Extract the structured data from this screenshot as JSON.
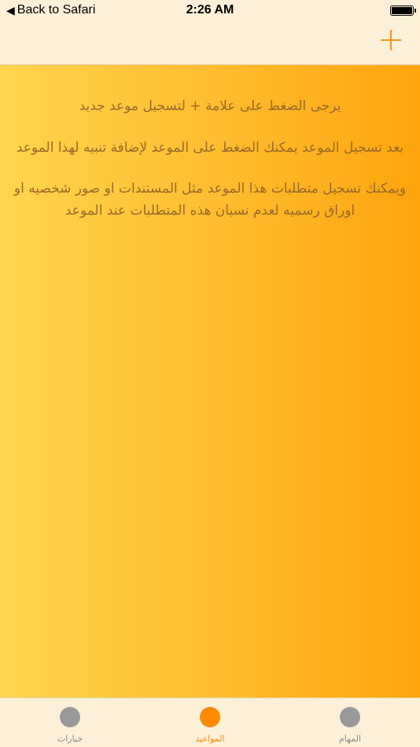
{
  "status_bar": {
    "back_label": "Back to Safari",
    "time": "2:26 AM"
  },
  "nav": {
    "add_icon": "plus-icon"
  },
  "instructions": {
    "line1": "يرجى الضغط على علامة + لتسجيل موعد جديد",
    "line2": "بعد تسجيل الموعد يمكنك الضغط على الموعد لإضافة تنبيه لهذا الموعد",
    "line3": "ويمكنك تسجيل متطلبات هذا الموعد مثل المستندات او صور شخصيه او اوراق رسميه لعدم نسيان هذه المتطلبات عند الموعد"
  },
  "tabs": [
    {
      "label": "خيارات",
      "active": false
    },
    {
      "label": "المواعيد",
      "active": true
    },
    {
      "label": "المهام",
      "active": false
    }
  ],
  "colors": {
    "accent": "#ff8a00",
    "inactive": "#999999",
    "text": "#9a6a2a"
  }
}
